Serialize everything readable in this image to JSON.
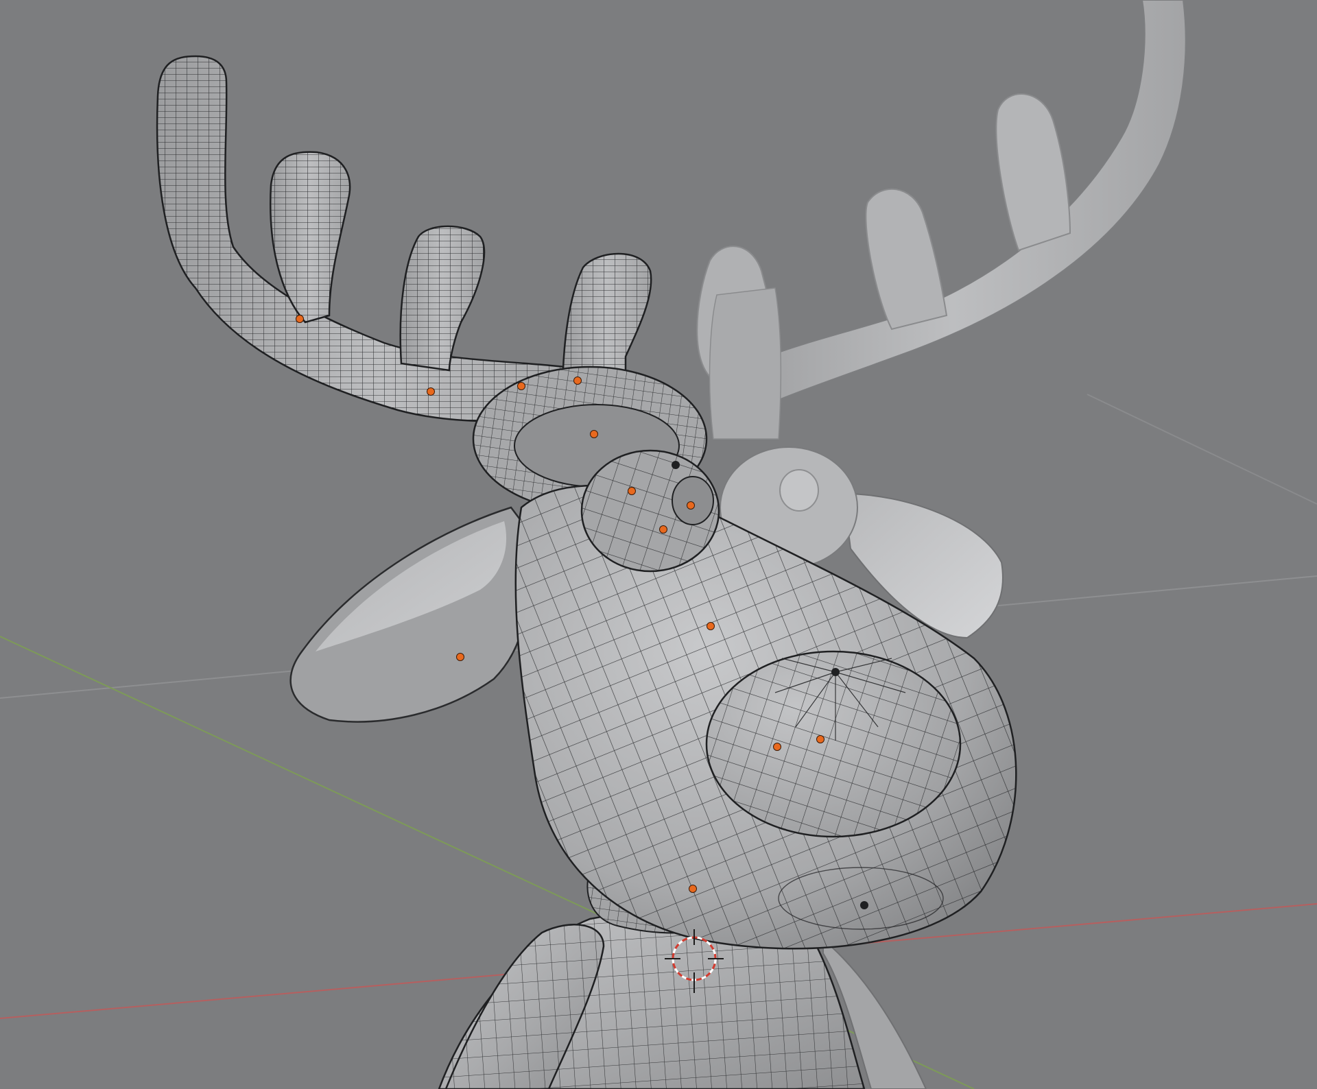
{
  "viewport": {
    "background": "#7c7d7f",
    "mesh_color": "#adaeb0",
    "wire_color": "#1f2022",
    "origin_color": "#e8691e",
    "axis_x_color": "#b65f5f",
    "axis_y_color": "#7d9a58"
  },
  "scene": {
    "objects": [
      {
        "name": "antler-left",
        "wireframe": true
      },
      {
        "name": "antler-right",
        "wireframe": false
      },
      {
        "name": "head",
        "wireframe": true
      },
      {
        "name": "nose",
        "wireframe": true
      },
      {
        "name": "eye-left",
        "wireframe": true
      },
      {
        "name": "eye-right",
        "wireframe": false
      },
      {
        "name": "ear-left",
        "wireframe": false
      },
      {
        "name": "ear-right",
        "wireframe": false
      },
      {
        "name": "body",
        "wireframe": true
      },
      {
        "name": "arm-left",
        "wireframe": true
      }
    ],
    "icons": [
      "3d-cursor-icon"
    ]
  }
}
